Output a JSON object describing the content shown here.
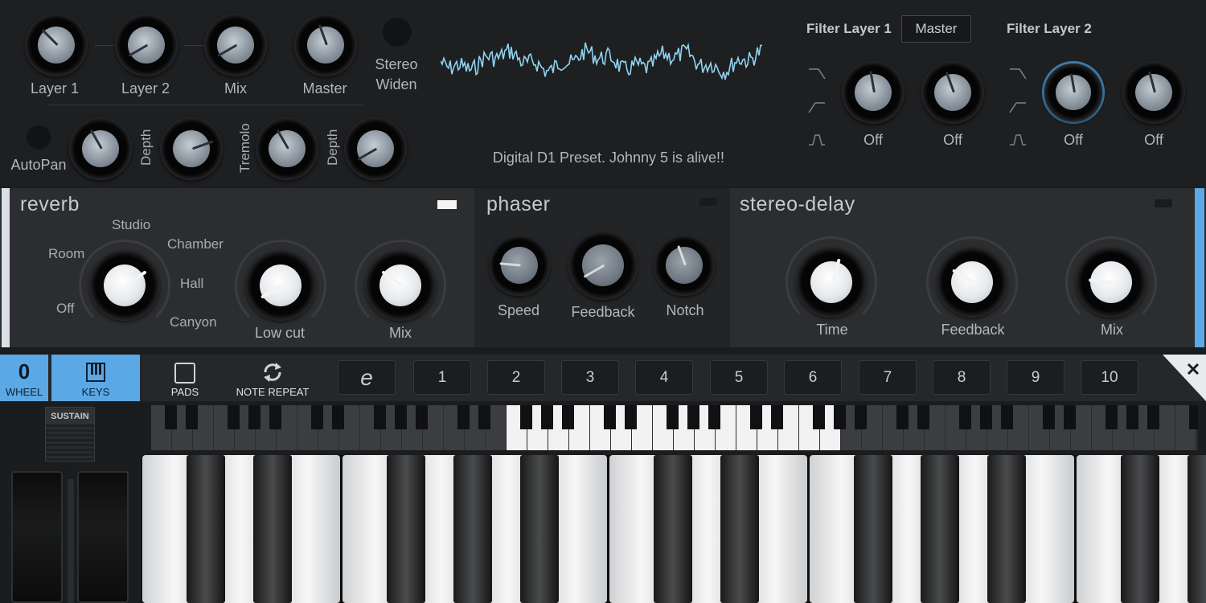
{
  "top": {
    "knob_labels": {
      "layer1": "Layer 1",
      "layer2": "Layer 2",
      "mix": "Mix",
      "master": "Master"
    },
    "stereo_widen": [
      "Stereo",
      "Widen"
    ],
    "autopan": "AutoPan",
    "depth1": "Depth",
    "tremolo": "Tremolo",
    "depth2": "Depth",
    "preset_text": "Digital D1 Preset. Johnny 5 is alive!!",
    "filter_layer_1": "Filter Layer 1",
    "master_button": "Master",
    "filter_layer_2": "Filter Layer 2",
    "filter_knob_labels": [
      "Off",
      "Off",
      "Off",
      "Off"
    ]
  },
  "reverb": {
    "title": "reverb",
    "types": {
      "room": "Room",
      "studio": "Studio",
      "chamber": "Chamber",
      "hall": "Hall",
      "canyon": "Canyon",
      "off": "Off"
    },
    "low_cut": "Low cut",
    "mix": "Mix"
  },
  "phaser": {
    "title": "phaser",
    "speed": "Speed",
    "feedback": "Feedback",
    "notch": "Notch"
  },
  "delay": {
    "title": "stereo-delay",
    "time": "Time",
    "feedback": "Feedback",
    "mix": "Mix"
  },
  "modes": {
    "wheel_value": "0",
    "wheel": "WHEEL",
    "keys": "KEYS",
    "pads": "PADS",
    "note_repeat": "NOTE REPEAT"
  },
  "slots": [
    "1",
    "2",
    "3",
    "4",
    "5",
    "6",
    "7",
    "8",
    "9",
    "10"
  ],
  "sustain": "SUSTAIN",
  "colors": {
    "accent": "#5aa8e6",
    "wave": "#8fd3f0",
    "panel": "#2b2c2e",
    "panel_dark": "#232426"
  }
}
